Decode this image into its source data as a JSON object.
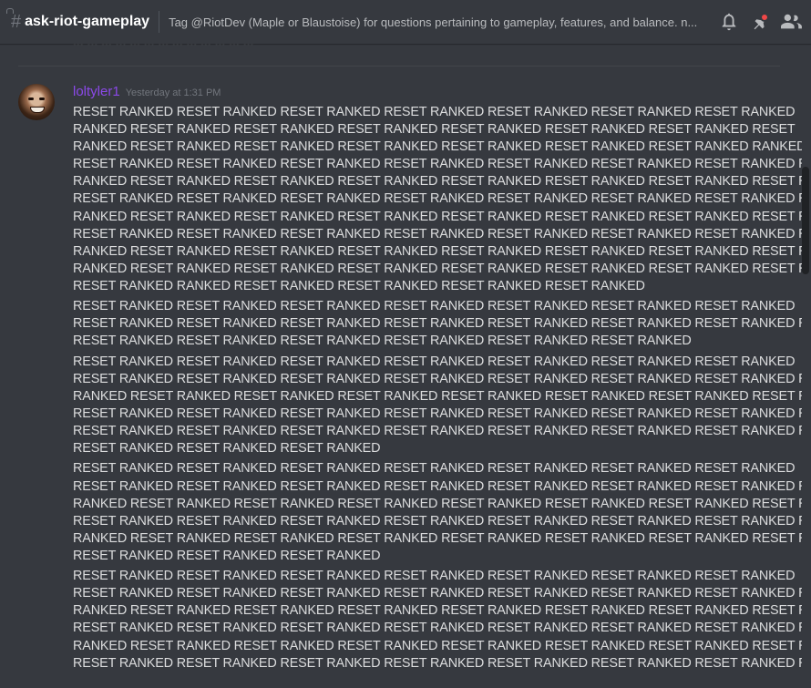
{
  "header": {
    "channel_name": "ask-riot-gameplay",
    "topic": "Tag @RiotDev (Maple or Blaustoise) for questions pertaining to gameplay, features, and balance. n...",
    "icons": [
      "bell-icon",
      "pin-icon",
      "members-icon"
    ]
  },
  "previous_message_fragment": "... ... ... ... ... ... ... ... ... ... ... ... ...",
  "message": {
    "username": "loltyler1",
    "username_color": "#8b49e8",
    "timestamp": "Yesterday at 1:31 PM",
    "paragraphs": [
      {
        "lines": [
          "RESET RANKED RESET RANKED RESET RANKED RESET RANKED RESET RANKED RESET RANKED RESET RANKED",
          "RANKED RESET RANKED RESET RANKED RESET RANKED RESET RANKED RESET RANKED RESET RANKED RESET",
          "RANKED RESET RANKED RESET RANKED RESET RANKED RESET RANKED RESET RANKED RESET RANKED RANKED",
          "RESET RANKED RESET RANKED RESET RANKED RESET RANKED RESET RANKED RESET RANKED RESET RANKED RESET",
          "RANKED RESET RANKED RESET RANKED RESET RANKED RESET RANKED RESET RANKED RESET RANKED RESET RANKED",
          "RESET RANKED RESET RANKED RESET RANKED RESET RANKED RESET RANKED RESET RANKED RESET RANKED RESET",
          "RANKED RESET RANKED RESET RANKED RESET RANKED RESET RANKED RESET RANKED RESET RANKED RESET RANKED",
          "RESET RANKED RESET RANKED RESET RANKED RESET RANKED RESET RANKED RESET RANKED RESET RANKED RESET",
          "RANKED RESET RANKED RESET RANKED RESET RANKED RESET RANKED RESET RANKED RESET RANKED RESET RESET",
          "RANKED RESET RANKED RESET RANKED RESET RANKED RESET RANKED RESET RANKED RESET RANKED RESET RANKED",
          "RESET RANKED  RANKED RESET RANKED RESET RANKED RESET RANKED RESET RANKED"
        ]
      },
      {
        "lines": [
          "RESET RANKED RESET RANKED RESET RANKED RESET RANKED RESET RANKED RESET RANKED RESET RANKED",
          "RESET RANKED RESET RANKED RESET RANKED RESET RANKED RESET RANKED RESET RANKED RESET RANKED RESET",
          "RESET RANKED RESET RANKED RESET RANKED RESET RANKED RESET RANKED RESET RANKED"
        ]
      },
      {
        "lines": [
          "RESET RANKED RESET RANKED RESET RANKED RESET RANKED RESET RANKED RESET RANKED RESET RANKED",
          "RESET RANKED RESET RANKED RESET RANKED RESET RANKED RESET RANKED RESET RANKED RESET RANKED RESET",
          "RANKED RESET RANKED RESET RANKED RESET RANKED RESET RANKED RESET RANKED RESET RANKED RESET RANKED",
          "RESET RANKED RESET RANKED RESET RANKED RESET RANKED RESET RANKED RESET RANKED RESET RANKED RESET",
          "RESET RANKED RESET RANKED RESET RANKED RESET RANKED RESET RANKED RESET RANKED RESET RANKED RESET",
          "RESET RANKED RESET RANKED RESET RANKED"
        ]
      },
      {
        "lines": [
          "RESET RANKED RESET RANKED RESET RANKED RESET RANKED RESET RANKED RESET RANKED RESET RANKED",
          "RESET RANKED RESET RANKED RESET RANKED RESET RANKED RESET RANKED RESET RANKED RESET RANKED RESET",
          "RANKED RESET RANKED RESET RANKED RESET RANKED RESET RANKED RESET RANKED RESET RANKED RESET RANKED",
          "RESET RANKED RESET RANKED RESET RANKED RESET RANKED RESET RANKED RESET RANKED RESET RANKED RESET",
          "RANKED RESET RANKED RESET RANKED RESET RANKED RESET RANKED RESET RANKED RESET RANKED RESET RANKED",
          "RESET RANKED RESET RANKED RESET RANKED"
        ]
      },
      {
        "lines": [
          "RESET RANKED RESET RANKED RESET RANKED RESET RANKED RESET RANKED RESET RANKED RESET RANKED",
          "RESET RANKED RESET RANKED RESET RANKED RESET RANKED RESET RANKED RESET RANKED RESET RANKED RESET",
          "RANKED RESET RANKED RESET RANKED RESET RANKED RESET RANKED RESET RANKED RESET RANKED RESET RANKED",
          "RESET RANKED RESET RANKED RESET RANKED RESET RANKED RESET RANKED RESET RANKED RESET RANKED RESET",
          "RANKED RESET RANKED RESET RANKED RESET RANKED RESET RANKED RESET RANKED RESET RANKED RESET RANKED",
          "RESET RANKED RESET RANKED RESET RANKED RESET RANKED RESET RANKED RESET RANKED RESET RANKED RESET"
        ]
      }
    ]
  }
}
